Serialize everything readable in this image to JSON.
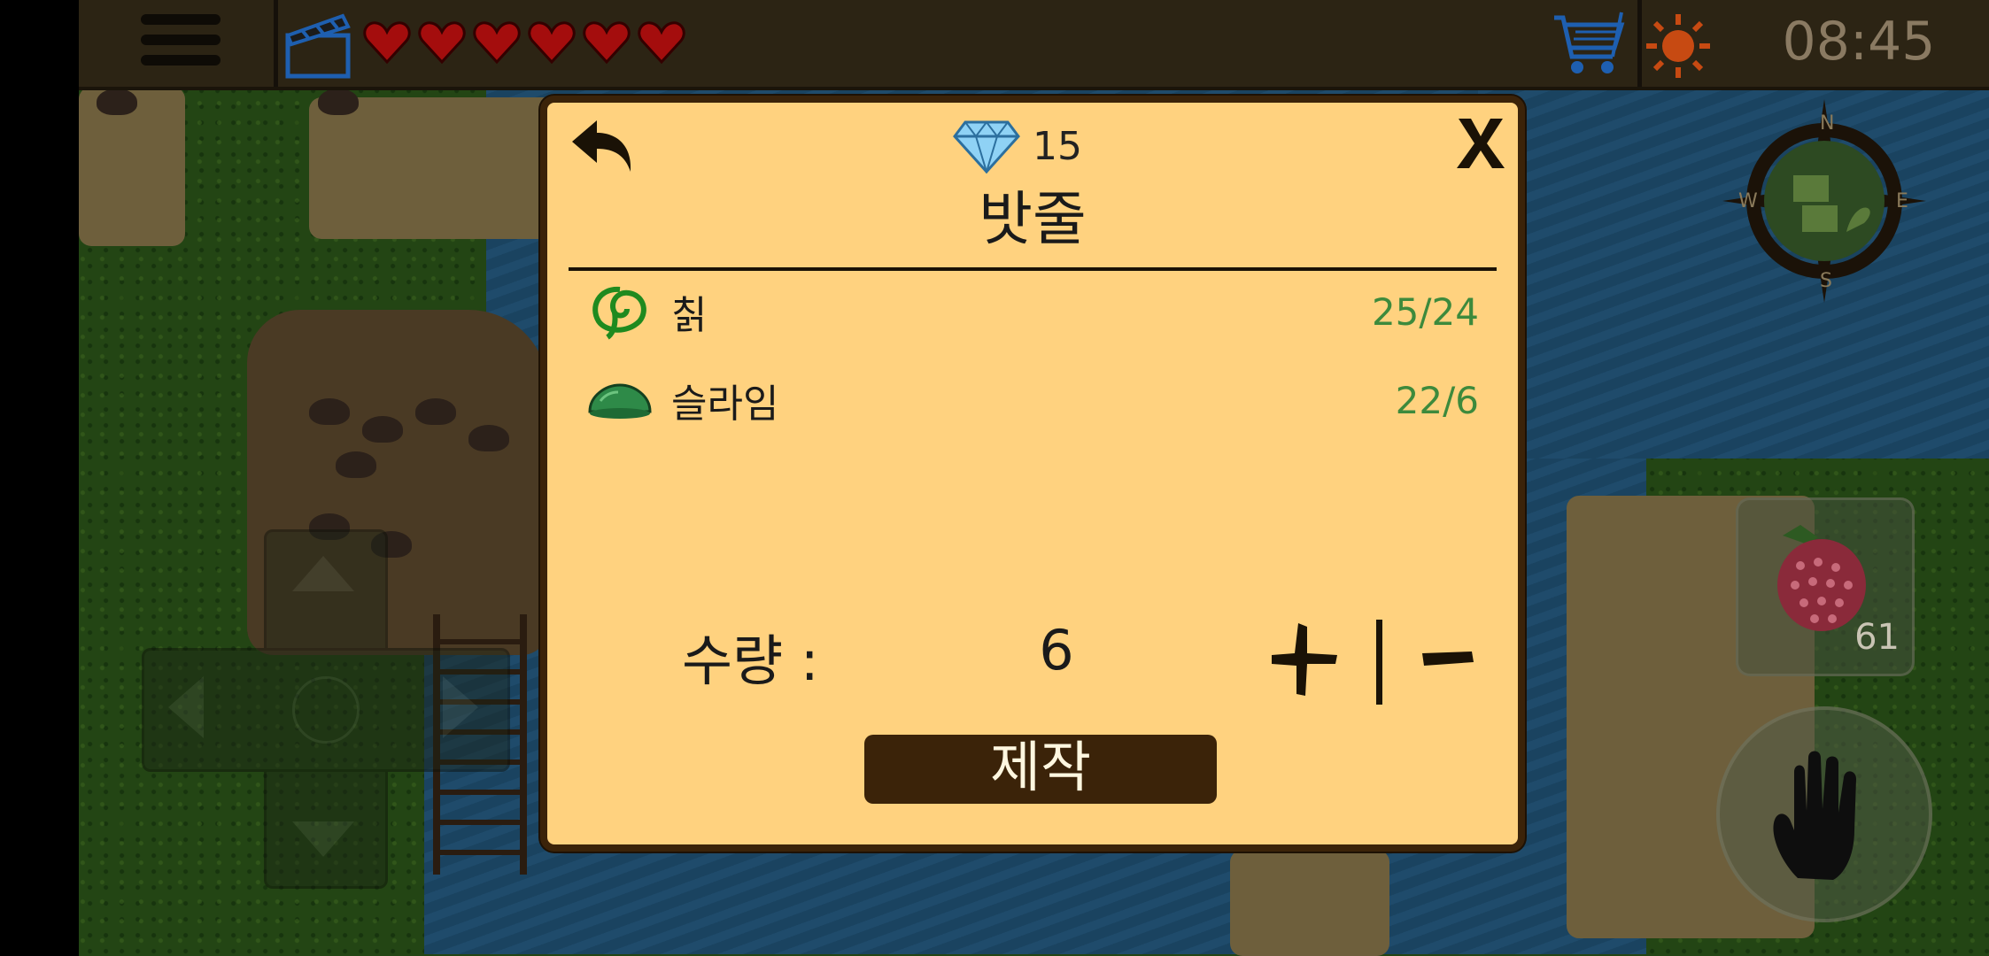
{
  "hud": {
    "hearts": 6,
    "time": "08:45",
    "icons": [
      "menu-icon",
      "clapper-icon",
      "heart-icon",
      "cart-icon",
      "sun-icon"
    ]
  },
  "craft_dialog": {
    "gem_count": "15",
    "title": "밧줄",
    "ingredients": [
      {
        "name": "칡",
        "amount": "25/24",
        "icon": "vine-icon"
      },
      {
        "name": "슬라임",
        "amount": "22/6",
        "icon": "slime-icon"
      }
    ],
    "quantity_label": "수량 :",
    "quantity_value": "6",
    "craft_label": "제작"
  },
  "quick_slot": {
    "item": "berry-icon",
    "count": "61"
  },
  "colors": {
    "dialog_bg": "#ffd27f",
    "dialog_border": "#3b2309",
    "ingredient_amount": "#3d8a3c",
    "hud_bg": "#2c2414"
  }
}
